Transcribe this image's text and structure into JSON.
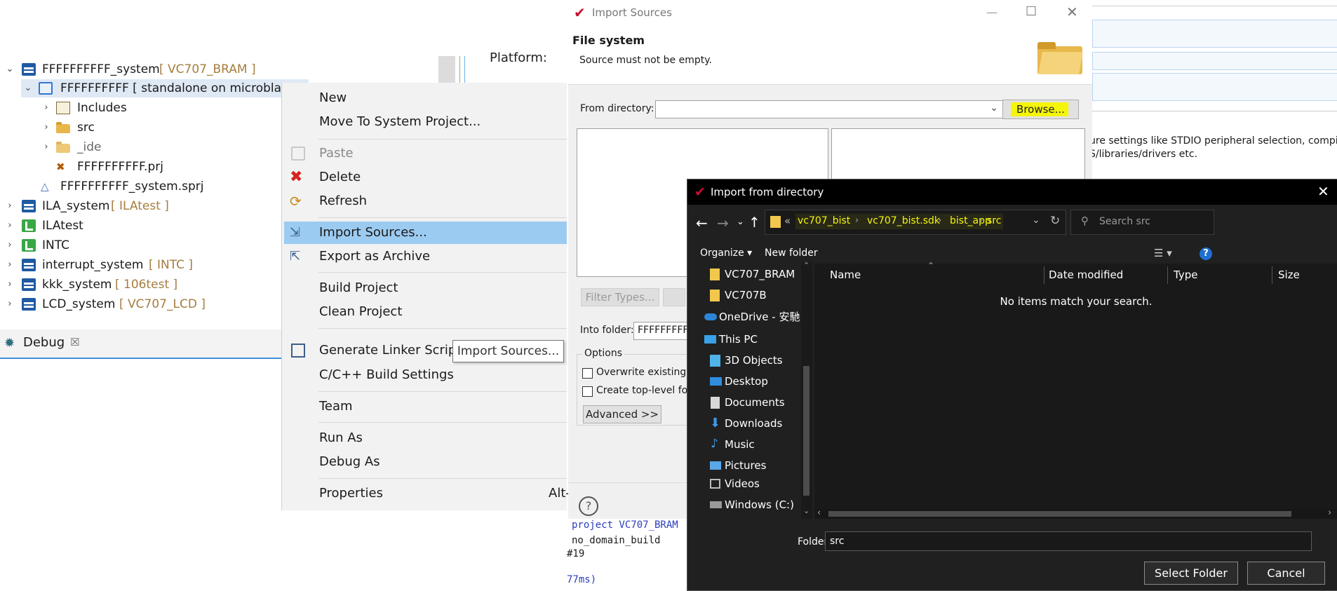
{
  "explorer": {
    "rows": [
      {
        "name": "FFFFFFFFFF_system",
        "tag": "[ VC707_BRAM ]"
      },
      {
        "name": "FFFFFFFFFF [ standalone on microblaz",
        "tag": ""
      },
      {
        "name": "Includes",
        "tag": ""
      },
      {
        "name": "src",
        "tag": ""
      },
      {
        "name": "_ide",
        "tag": ""
      },
      {
        "name": "FFFFFFFFFF.prj",
        "tag": ""
      },
      {
        "name": "FFFFFFFFFF_system.sprj",
        "tag": ""
      },
      {
        "name": "ILA_system",
        "tag": "[ ILAtest ]"
      },
      {
        "name": "ILAtest",
        "tag": ""
      },
      {
        "name": "INTC",
        "tag": ""
      },
      {
        "name": "interrupt_system",
        "tag": "[ INTC ]"
      },
      {
        "name": "kkk_system",
        "tag": "[ 106test ]"
      },
      {
        "name": "LCD_system",
        "tag": "[ VC707_LCD ]"
      }
    ],
    "debug_tab": "Debug",
    "platform_label": "Platform:"
  },
  "context_menu": {
    "items": [
      "New",
      "Move To System Project...",
      "Paste",
      "Delete",
      "Refresh",
      "Import Sources...",
      "Export as Archive",
      "Build Project",
      "Clean Project",
      "Generate Linker Script",
      "C/C++ Build Settings",
      "Team",
      "Run As",
      "Debug As",
      "Properties"
    ],
    "properties_shortcut": "Alt-",
    "tooltip": "Import Sources..."
  },
  "import_dialog": {
    "title": "Import Sources",
    "section_title": "File system",
    "message": "Source must not be empty.",
    "from_directory_label": "From directory:",
    "from_directory_value": "",
    "browse_button": "Browse...",
    "filter_types_button": "Filter Types...",
    "into_folder_label": "Into folder:",
    "into_folder_value": "FFFFFFFFF",
    "options_label": "Options",
    "overwrite_label": "Overwrite existing r",
    "create_top_label": "Create top-level fold",
    "advanced_button": "Advanced >>",
    "help_icon_glyph": "?"
  },
  "editor_fragment": {
    "line1": "ure settings like STDIO peripheral selection, compiler fl",
    "line2": "S/libraries/drivers etc."
  },
  "console": {
    "line1": "project VC707_BRAM",
    "line2": "no_domain_build",
    "line3": "#19",
    "line4": "77ms)"
  },
  "folder_dialog": {
    "title": "Import from directory",
    "breadcrumb": [
      "vc707_bist",
      "vc707_bist.sdk",
      "bist_app",
      "src"
    ],
    "breadcrumb_overflow": "«",
    "search_placeholder": "Search src",
    "organize_label": "Organize",
    "new_folder_label": "New folder",
    "columns": [
      "Name",
      "Date modified",
      "Type",
      "Size"
    ],
    "empty_message": "No items match your search.",
    "nav": [
      {
        "label": "VC707_BRAM",
        "icon": "folder-icon"
      },
      {
        "label": "VC707B",
        "icon": "folder-icon"
      },
      {
        "label": "OneDrive - 安馳科",
        "icon": "cloud-icon"
      },
      {
        "label": "This PC",
        "icon": "computer-icon"
      },
      {
        "label": "3D Objects",
        "icon": "cube-icon"
      },
      {
        "label": "Desktop",
        "icon": "desktop-icon"
      },
      {
        "label": "Documents",
        "icon": "document-icon"
      },
      {
        "label": "Downloads",
        "icon": "download-icon"
      },
      {
        "label": "Music",
        "icon": "music-icon"
      },
      {
        "label": "Pictures",
        "icon": "picture-icon"
      },
      {
        "label": "Videos",
        "icon": "video-icon"
      },
      {
        "label": "Windows (C:)",
        "icon": "drive-icon"
      }
    ],
    "folder_label": "Folder:",
    "folder_value": "src",
    "select_button": "Select Folder",
    "cancel_button": "Cancel"
  },
  "colors": {
    "menu_highlight": "#9ccbf1",
    "browse_highlight": "#f5f50a",
    "breadcrumb_highlight": "#f5f50a",
    "dark_bg": "#202020",
    "tag_color": "#a57d3f"
  }
}
